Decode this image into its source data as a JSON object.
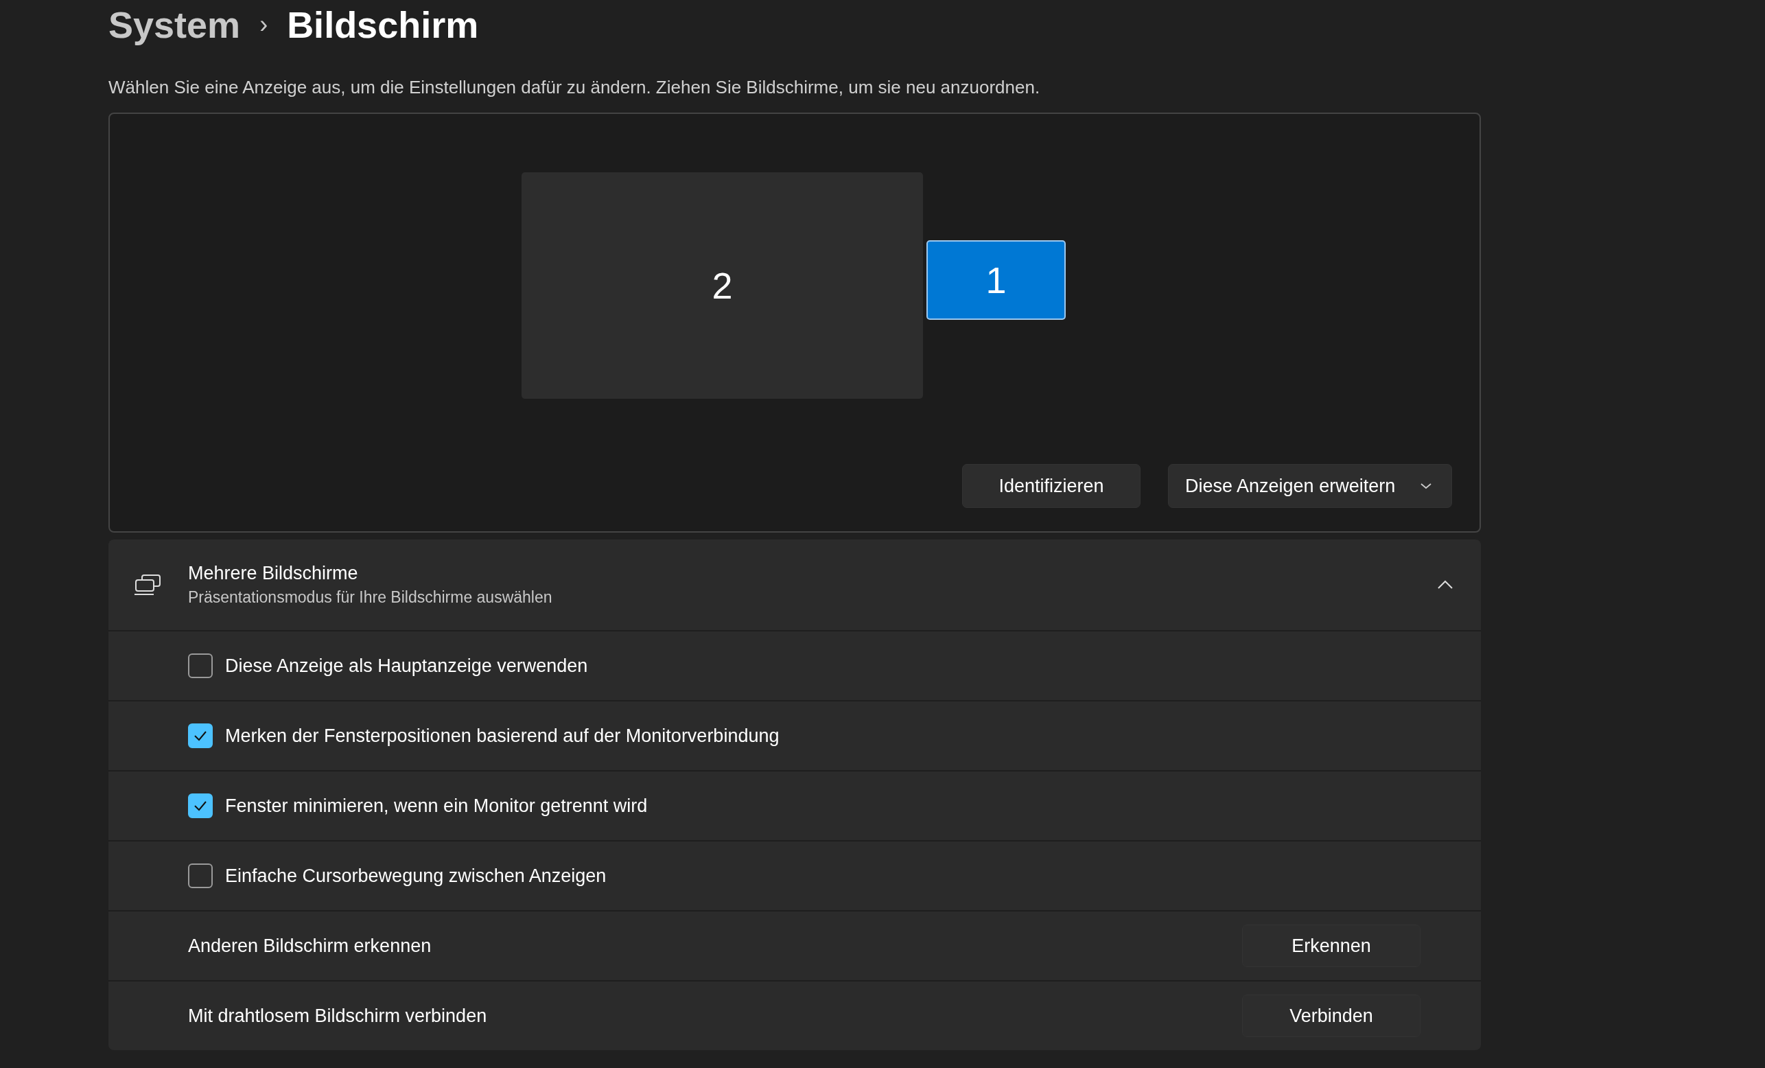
{
  "breadcrumb": {
    "parent": "System",
    "separator": "›",
    "current": "Bildschirm"
  },
  "description": "Wählen Sie eine Anzeige aus, um die Einstellungen dafür zu ändern. Ziehen Sie Bildschirme, um sie neu anzuordnen.",
  "arrangement": {
    "monitors": [
      {
        "label": "2",
        "selected": false
      },
      {
        "label": "1",
        "selected": true
      }
    ],
    "identify_button": "Identifizieren",
    "mode_dropdown": {
      "value": "Diese Anzeigen erweitern"
    }
  },
  "multiple_displays": {
    "title": "Mehrere Bildschirme",
    "subtitle": "Präsentationsmodus für Ihre Bildschirme auswählen",
    "expanded": true,
    "rows": [
      {
        "kind": "checkbox",
        "label": "Diese Anzeige als Hauptanzeige verwenden",
        "checked": false
      },
      {
        "kind": "checkbox",
        "label": "Merken der Fensterpositionen basierend auf der Monitorverbindung",
        "checked": true
      },
      {
        "kind": "checkbox",
        "label": "Fenster minimieren, wenn ein Monitor getrennt wird",
        "checked": true
      },
      {
        "kind": "checkbox",
        "label": "Einfache Cursorbewegung zwischen Anzeigen",
        "checked": false
      },
      {
        "kind": "button",
        "label": "Anderen Bildschirm erkennen",
        "button": "Erkennen"
      },
      {
        "kind": "button",
        "label": "Mit drahtlosem Bildschirm verbinden",
        "button": "Verbinden"
      }
    ]
  }
}
